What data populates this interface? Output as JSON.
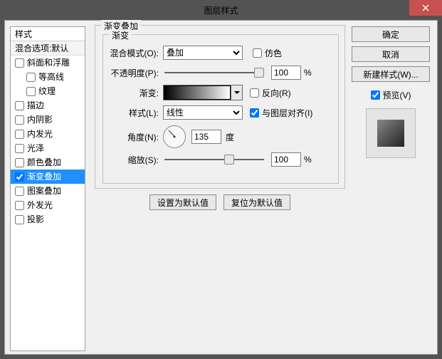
{
  "window": {
    "title": "图层样式"
  },
  "close": "×",
  "styles": {
    "header": "样式",
    "subheader": "混合选项:默认",
    "items": [
      {
        "label": "斜面和浮雕",
        "checked": false,
        "selected": false,
        "indent": false
      },
      {
        "label": "等高线",
        "checked": false,
        "selected": false,
        "indent": true
      },
      {
        "label": "纹理",
        "checked": false,
        "selected": false,
        "indent": true
      },
      {
        "label": "描边",
        "checked": false,
        "selected": false,
        "indent": false
      },
      {
        "label": "内阴影",
        "checked": false,
        "selected": false,
        "indent": false
      },
      {
        "label": "内发光",
        "checked": false,
        "selected": false,
        "indent": false
      },
      {
        "label": "光泽",
        "checked": false,
        "selected": false,
        "indent": false
      },
      {
        "label": "颜色叠加",
        "checked": false,
        "selected": false,
        "indent": false
      },
      {
        "label": "渐变叠加",
        "checked": true,
        "selected": true,
        "indent": false
      },
      {
        "label": "图案叠加",
        "checked": false,
        "selected": false,
        "indent": false
      },
      {
        "label": "外发光",
        "checked": false,
        "selected": false,
        "indent": false
      },
      {
        "label": "投影",
        "checked": false,
        "selected": false,
        "indent": false
      }
    ]
  },
  "grad": {
    "group_title": "渐变叠加",
    "sub_title": "渐变",
    "blend_label": "混合模式(O):",
    "blend_value": "叠加",
    "dither_label": "仿色",
    "opacity_label": "不透明度(P):",
    "opacity_value": "100",
    "pct": "%",
    "gradient_label": "渐变:",
    "reverse_label": "反向(R)",
    "style_label": "样式(L):",
    "style_value": "线性",
    "align_label": "与图层对齐(I)",
    "angle_label": "角度(N):",
    "angle_value": "135",
    "angle_unit": "度",
    "scale_label": "缩放(S):",
    "scale_value": "100"
  },
  "defaults": {
    "set": "设置为默认值",
    "reset": "复位为默认值"
  },
  "right": {
    "ok": "确定",
    "cancel": "取消",
    "new_style": "新建样式(W)...",
    "preview_label": "预览(V)",
    "preview_checked": true
  }
}
